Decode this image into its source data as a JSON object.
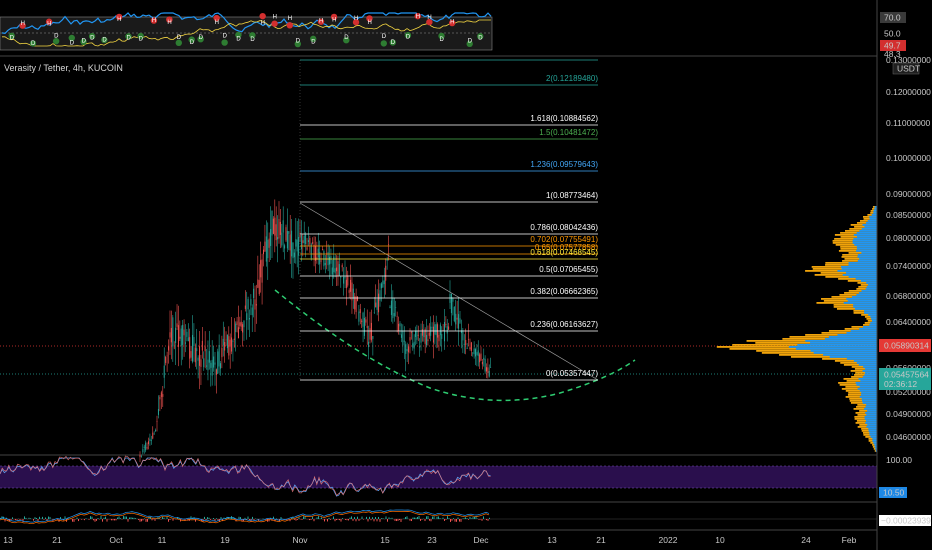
{
  "symbol_title": "Verasity / Tether, 4h, KUCOIN",
  "currency_badge": "USDT",
  "colors": {
    "bg": "#000000",
    "bull": "#26a69a",
    "bear": "#ef5350",
    "curve": "#2ecc71",
    "vp_blue": "#2196f3",
    "vp_orange": "#f0a30a",
    "rsi_fill": "#2a0f4d",
    "price_red": "#e53935"
  },
  "top_indicator": {
    "levels": [
      "70.0",
      "50.0"
    ],
    "current": "49.7",
    "current2": "48.3"
  },
  "price_axis": {
    "labels": [
      "0.12000000",
      "0.11000000",
      "0.10000000",
      "0.09000000",
      "0.08500000",
      "0.08000000",
      "0.07400000",
      "0.06800000",
      "0.06400000",
      "0.06000000",
      "0.05600000",
      "0.05200000",
      "0.04900000",
      "0.04600000"
    ],
    "first_label": "0.13000000",
    "red_label": "0.05890314",
    "current_label": "0.05457564",
    "countdown": "02:36:12"
  },
  "fib_levels": [
    {
      "label": "2(0.12189480)",
      "color": "#26a69a"
    },
    {
      "label": "1.618(0.10884562)",
      "color": "#ffffff"
    },
    {
      "label": "1.5(0.10481472)",
      "color": "#4caf50"
    },
    {
      "label": "1.236(0.09579643)",
      "color": "#42a5f5"
    },
    {
      "label": "1(0.08773464)",
      "color": "#ffffff"
    },
    {
      "label": "0.786(0.08042436)",
      "color": "#ffffff"
    },
    {
      "label": "0.702(0.07755491)",
      "color": "#ff9800"
    },
    {
      "label": "0.65(0.07577858)",
      "color": "#ff9800"
    },
    {
      "label": "0.618(0.07468545)",
      "color": "#ffeb3b"
    },
    {
      "label": "0.5(0.07065455)",
      "color": "#ffffff"
    },
    {
      "label": "0.382(0.06662365)",
      "color": "#ffffff"
    },
    {
      "label": "0.236(0.06163627)",
      "color": "#ffffff"
    },
    {
      "label": "0(0.05357447)",
      "color": "#ffffff"
    }
  ],
  "rsi": {
    "upper": "100.00",
    "current": "10.50"
  },
  "macd": {
    "current": "−0.00023939"
  },
  "time_axis": [
    "13",
    "21",
    "Oct",
    "11",
    "19",
    "Nov",
    "15",
    "23",
    "Dec",
    "13",
    "21",
    "2022",
    "10",
    "24",
    "Feb"
  ]
}
